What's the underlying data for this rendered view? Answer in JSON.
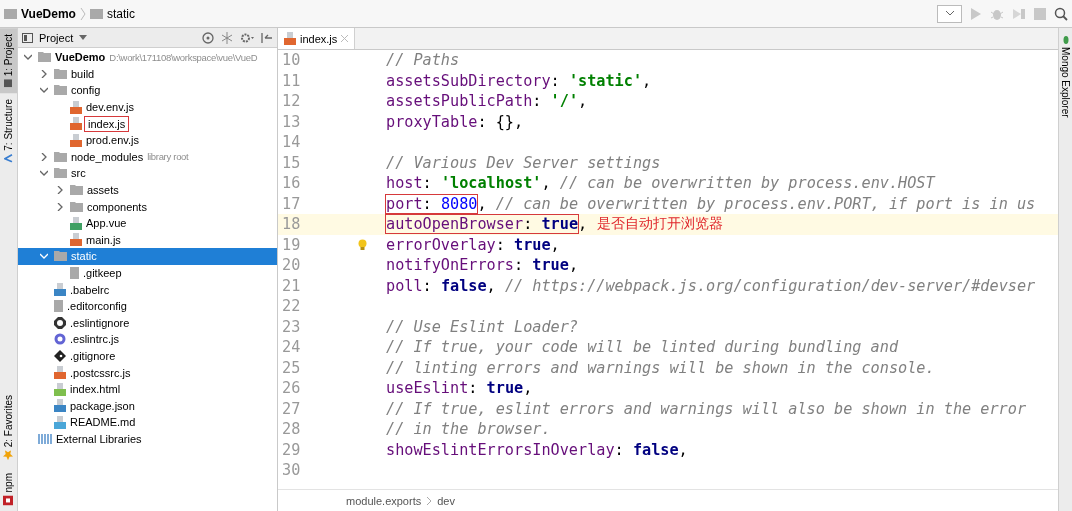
{
  "navbar": {
    "crumbs": [
      "VueDemo",
      "static"
    ]
  },
  "left_strip": [
    {
      "label": "1: Project",
      "selected": true,
      "kind": "project"
    },
    {
      "label": "7: Structure",
      "selected": false,
      "kind": "structure"
    },
    {
      "label": "2: Favorites",
      "selected": false,
      "kind": "favorites"
    },
    {
      "label": "npm",
      "selected": false,
      "kind": "npm"
    }
  ],
  "right_strip": [
    {
      "label": "Mongo Explorer",
      "kind": "mongo"
    }
  ],
  "project": {
    "title": "Project",
    "tree": [
      {
        "label": "VueDemo",
        "kind": "folder",
        "bold": true,
        "hint": "D:\\work\\171108\\workspace\\vue\\VueD",
        "expanded": true,
        "selected": false,
        "children": [
          {
            "label": "build",
            "kind": "folder",
            "expanded": false,
            "selected": false
          },
          {
            "label": "config",
            "kind": "folder",
            "expanded": true,
            "selected": false,
            "children": [
              {
                "label": "dev.env.js",
                "kind": "js",
                "selected": false
              },
              {
                "label": "index.js",
                "kind": "js",
                "boxed": true,
                "selected": false
              },
              {
                "label": "prod.env.js",
                "kind": "js",
                "selected": false
              }
            ]
          },
          {
            "label": "node_modules",
            "kind": "folder",
            "hint": "library root",
            "expanded": false,
            "selected": false
          },
          {
            "label": "src",
            "kind": "folder",
            "expanded": true,
            "selected": false,
            "children": [
              {
                "label": "assets",
                "kind": "folder",
                "expanded": false,
                "selected": false
              },
              {
                "label": "components",
                "kind": "folder",
                "expanded": false,
                "selected": false
              },
              {
                "label": "App.vue",
                "kind": "vue",
                "selected": false
              },
              {
                "label": "main.js",
                "kind": "js",
                "selected": false
              }
            ]
          },
          {
            "label": "static",
            "kind": "folder",
            "expanded": true,
            "selected": true,
            "children": [
              {
                "label": ".gitkeep",
                "kind": "plain",
                "selected": false
              }
            ]
          },
          {
            "label": ".babelrc",
            "kind": "json",
            "selected": false
          },
          {
            "label": ".editorconfig",
            "kind": "plain",
            "selected": false
          },
          {
            "label": ".eslintignore",
            "kind": "eslintignore",
            "selected": false
          },
          {
            "label": ".eslintrc.js",
            "kind": "eslint",
            "selected": false
          },
          {
            "label": ".gitignore",
            "kind": "git",
            "selected": false
          },
          {
            "label": ".postcssrc.js",
            "kind": "js",
            "selected": false
          },
          {
            "label": "index.html",
            "kind": "html",
            "selected": false
          },
          {
            "label": "package.json",
            "kind": "json",
            "selected": false
          },
          {
            "label": "README.md",
            "kind": "md",
            "selected": false
          }
        ]
      },
      {
        "label": "External Libraries",
        "kind": "library",
        "selected": false
      }
    ]
  },
  "editor": {
    "tabs": [
      {
        "label": "index.js",
        "selected": true
      }
    ],
    "lines": [
      {
        "number": "10",
        "tokens": [
          {
            "kind": "comment",
            "text": "// Paths"
          }
        ]
      },
      {
        "number": "11",
        "tokens": [
          {
            "kind": "key",
            "text": "assetsSubDirectory"
          },
          {
            "kind": "plain",
            "text": ": "
          },
          {
            "kind": "string",
            "text": "'static'"
          },
          {
            "kind": "plain",
            "text": ","
          }
        ]
      },
      {
        "number": "12",
        "tokens": [
          {
            "kind": "key",
            "text": "assetsPublicPath"
          },
          {
            "kind": "plain",
            "text": ": "
          },
          {
            "kind": "string",
            "text": "'/'"
          },
          {
            "kind": "plain",
            "text": ","
          }
        ]
      },
      {
        "number": "13",
        "tokens": [
          {
            "kind": "key",
            "text": "proxyTable"
          },
          {
            "kind": "plain",
            "text": ": {},"
          }
        ]
      },
      {
        "number": "14"
      },
      {
        "number": "15",
        "tokens": [
          {
            "kind": "comment",
            "text": "// Various Dev Server settings"
          }
        ]
      },
      {
        "number": "16",
        "tokens": [
          {
            "kind": "key",
            "text": "host"
          },
          {
            "kind": "plain",
            "text": ": "
          },
          {
            "kind": "string",
            "text": "'localhost'"
          },
          {
            "kind": "plain",
            "text": ", "
          },
          {
            "kind": "comment",
            "text": "// can be overwritten by process.env.HOST"
          }
        ]
      },
      {
        "number": "17",
        "tokens": [
          {
            "kind": "key",
            "text": "port",
            "boxed": true
          },
          {
            "kind": "plain",
            "text": ": ",
            "boxed": true
          },
          {
            "kind": "number",
            "text": "8080",
            "boxed": true
          },
          {
            "kind": "plain",
            "text": ", "
          },
          {
            "kind": "comment",
            "text": "// can be overwritten by process.env.PORT, if port is in us"
          }
        ]
      },
      {
        "number": "18",
        "current": true,
        "note": "是否自动打开浏览器",
        "tokens": [
          {
            "kind": "key",
            "text": "autoOpenBrowser",
            "boxed": true
          },
          {
            "kind": "plain",
            "text": ": ",
            "boxed": true
          },
          {
            "kind": "keyword",
            "text": "true",
            "boxed": true
          },
          {
            "kind": "plain",
            "text": ","
          }
        ]
      },
      {
        "number": "19",
        "bulb": true,
        "tokens": [
          {
            "kind": "key",
            "text": "errorOverlay"
          },
          {
            "kind": "plain",
            "text": ": "
          },
          {
            "kind": "keyword",
            "text": "true"
          },
          {
            "kind": "plain",
            "text": ","
          }
        ]
      },
      {
        "number": "20",
        "tokens": [
          {
            "kind": "key",
            "text": "notifyOnErrors"
          },
          {
            "kind": "plain",
            "text": ": "
          },
          {
            "kind": "keyword",
            "text": "true"
          },
          {
            "kind": "plain",
            "text": ","
          }
        ]
      },
      {
        "number": "21",
        "tokens": [
          {
            "kind": "key",
            "text": "poll"
          },
          {
            "kind": "plain",
            "text": ": "
          },
          {
            "kind": "keyword",
            "text": "false"
          },
          {
            "kind": "plain",
            "text": ", "
          },
          {
            "kind": "comment",
            "text": "// https://webpack.js.org/configuration/dev-server/#devser"
          }
        ]
      },
      {
        "number": "22"
      },
      {
        "number": "23",
        "tokens": [
          {
            "kind": "comment",
            "text": "// Use Eslint Loader?"
          }
        ]
      },
      {
        "number": "24",
        "tokens": [
          {
            "kind": "comment",
            "text": "// If true, your code will be linted during bundling and"
          }
        ]
      },
      {
        "number": "25",
        "tokens": [
          {
            "kind": "comment",
            "text": "// linting errors and warnings will be shown in the console."
          }
        ]
      },
      {
        "number": "26",
        "tokens": [
          {
            "kind": "key",
            "text": "useEslint"
          },
          {
            "kind": "plain",
            "text": ": "
          },
          {
            "kind": "keyword",
            "text": "true"
          },
          {
            "kind": "plain",
            "text": ","
          }
        ]
      },
      {
        "number": "27",
        "tokens": [
          {
            "kind": "comment",
            "text": "// If true, eslint errors and warnings will also be shown in the error"
          }
        ]
      },
      {
        "number": "28",
        "tokens": [
          {
            "kind": "comment",
            "text": "// in the browser."
          }
        ]
      },
      {
        "number": "29",
        "tokens": [
          {
            "kind": "key",
            "text": "showEslintErrorsInOverlay"
          },
          {
            "kind": "plain",
            "text": ": "
          },
          {
            "kind": "keyword",
            "text": "false"
          },
          {
            "kind": "plain",
            "text": ","
          }
        ]
      },
      {
        "number": "30"
      }
    ],
    "breadcrumbs": [
      "module.exports",
      "dev"
    ]
  }
}
